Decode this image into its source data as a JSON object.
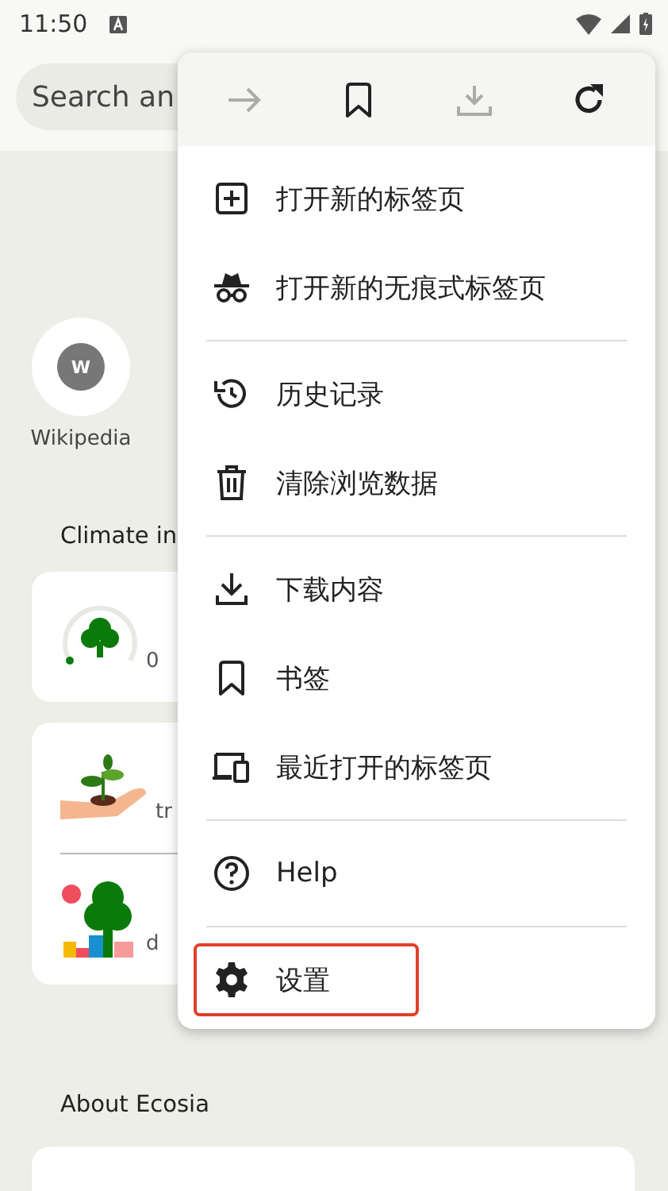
{
  "status_bar": {
    "time": "11:50"
  },
  "search": {
    "placeholder": "Search an"
  },
  "shortcuts": [
    {
      "letter": "W",
      "label": "Wikipedia"
    }
  ],
  "climate": {
    "title": "Climate in",
    "cards": [
      {
        "rows": [
          {
            "caption": "0"
          }
        ]
      },
      {
        "rows": [
          {
            "caption": "tr"
          },
          {
            "caption": "d"
          }
        ]
      }
    ]
  },
  "about": {
    "title": "About Ecosia"
  },
  "menu": {
    "toolbar": [
      {
        "kind": "forward",
        "disabled": true
      },
      {
        "kind": "bookmark",
        "disabled": false
      },
      {
        "kind": "download",
        "disabled": true
      },
      {
        "kind": "reload",
        "disabled": false
      }
    ],
    "groups": [
      {
        "items": [
          {
            "label": "打开新的标签页",
            "highlighted": false
          },
          {
            "label": "打开新的无痕式标签页",
            "highlighted": false
          }
        ]
      },
      {
        "items": [
          {
            "label": "历史记录",
            "highlighted": false
          },
          {
            "label": "清除浏览数据",
            "highlighted": false
          }
        ]
      },
      {
        "items": [
          {
            "label": "下载内容",
            "highlighted": false
          },
          {
            "label": "书签",
            "highlighted": false
          },
          {
            "label": "最近打开的标签页",
            "highlighted": false
          }
        ]
      },
      {
        "items": [
          {
            "label": "Help",
            "highlighted": false
          }
        ]
      },
      {
        "items": [
          {
            "label": "设置",
            "highlighted": true
          }
        ]
      }
    ]
  }
}
